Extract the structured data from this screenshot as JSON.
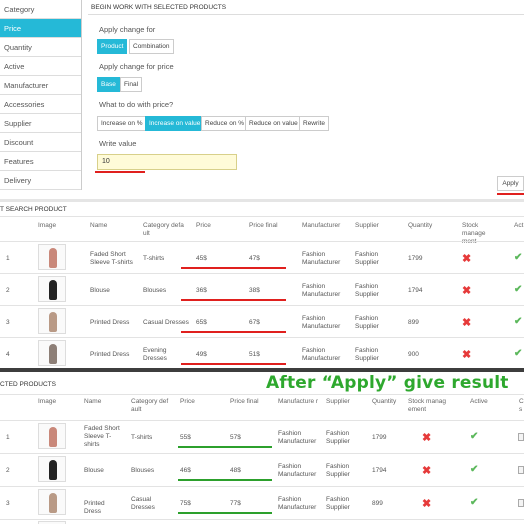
{
  "sidebar": {
    "items": [
      {
        "label": "Category"
      },
      {
        "label": "Price"
      },
      {
        "label": "Quantity"
      },
      {
        "label": "Active"
      },
      {
        "label": "Manufacturer"
      },
      {
        "label": "Accessories"
      },
      {
        "label": "Supplier"
      },
      {
        "label": "Discount"
      },
      {
        "label": "Features"
      },
      {
        "label": "Delivery"
      }
    ]
  },
  "panel": {
    "title": "BEGIN WORK WITH SELECTED PRODUCTS",
    "apply_change_for_label": "Apply change for",
    "apply_change_for_options": [
      "Product",
      "Combination"
    ],
    "apply_change_for_price_label": "Apply change for price",
    "price_options": [
      "Base",
      "Final"
    ],
    "what_to_do_label": "What to do with price?",
    "actions": [
      "Increase on %",
      "Increase on value",
      "Reduce on %",
      "Reduce on value",
      "Rewrite"
    ],
    "write_value_label": "Write value",
    "write_value": "10",
    "apply_label": "Apply"
  },
  "search": {
    "title": "T SEARCH PRODUCT",
    "headers": [
      "Image",
      "Name",
      "Category defa ult",
      "Price",
      "Price final",
      "Manufacturer",
      "Supplier",
      "Quantity",
      "Stock manage ment",
      "Act"
    ],
    "rows": [
      {
        "id": "1",
        "name": "Faded Short Sleeve T-shirts",
        "category": "T-shirts",
        "price": "45$",
        "final": "47$",
        "manufacturer": "Fashion Manufacturer",
        "supplier": "Fashion Supplier",
        "qty": "1799",
        "dress_color": "#c9887a"
      },
      {
        "id": "2",
        "name": "Blouse",
        "category": "Blouses",
        "price": "36$",
        "final": "38$",
        "manufacturer": "Fashion Manufacturer",
        "supplier": "Fashion Supplier",
        "qty": "1794",
        "dress_color": "#222222"
      },
      {
        "id": "3",
        "name": "Printed Dress",
        "category": "Casual Dresses",
        "price": "65$",
        "final": "67$",
        "manufacturer": "Fashion Manufacturer",
        "supplier": "Fashion Supplier",
        "qty": "899",
        "dress_color": "#b99a86"
      },
      {
        "id": "4",
        "name": "Printed Dress",
        "category": "Evening Dresses",
        "price": "49$",
        "final": "51$",
        "manufacturer": "Fashion Manufacturer",
        "supplier": "Fashion Supplier",
        "qty": "900",
        "dress_color": "#8d7f77"
      }
    ]
  },
  "result": {
    "title": "CTED PRODUCTS",
    "banner": "After “Apply” give result",
    "headers": [
      "Image",
      "Name",
      "Category def ault",
      "Price",
      "Price final",
      "Manufacture r",
      "Supplier",
      "Quantity",
      "Stock manag ement",
      "Active",
      "C s"
    ],
    "rows": [
      {
        "id": "1",
        "name": "Faded Short Sleeve T- shirts",
        "category": "T-shirts",
        "price": "55$",
        "final": "57$",
        "manufacturer": "Fashion Manufacturer",
        "supplier": "Fashion Supplier",
        "qty": "1799",
        "dress_color": "#c9887a"
      },
      {
        "id": "2",
        "name": "Blouse",
        "category": "Blouses",
        "price": "46$",
        "final": "48$",
        "manufacturer": "Fashion Manufacturer",
        "supplier": "Fashion Supplier",
        "qty": "1794",
        "dress_color": "#222222"
      },
      {
        "id": "3",
        "name": "Printed Dress",
        "category": "Casual Dresses",
        "price": "75$",
        "final": "77$",
        "manufacturer": "Fashion Manufacturer",
        "supplier": "Fashion Supplier",
        "qty": "899",
        "dress_color": "#b99a86"
      }
    ]
  },
  "icons": {
    "cross": "✖",
    "check": "✔"
  },
  "colors": {
    "accent": "#25b9d7",
    "highlight_red": "#e0201e",
    "highlight_green": "#2ca02c"
  }
}
